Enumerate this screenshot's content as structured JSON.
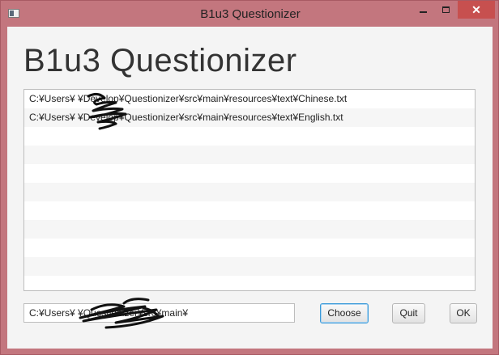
{
  "window": {
    "title": "B1u3 Questionizer",
    "controls": {
      "minimize": "",
      "maximize": "",
      "close": "✕"
    }
  },
  "main": {
    "heading": "B1u3 Questionizer",
    "files": [
      "C:¥Users¥          ¥Develop¥Questionizer¥src¥main¥resources¥text¥Chinese.txt",
      "C:¥Users¥          ¥Develop¥Questionizer¥src¥main¥resources¥text¥English.txt",
      "",
      "",
      "",
      "",
      "",
      "",
      "",
      "",
      ""
    ]
  },
  "footer": {
    "path_value": "C:¥Users¥              ¥Questionizer¥src¥main¥",
    "choose_label": "Choose",
    "quit_label": "Quit",
    "ok_label": "OK"
  },
  "colors": {
    "frame": "#c3767e",
    "close": "#c7504f",
    "focus": "#3a9ad9"
  }
}
